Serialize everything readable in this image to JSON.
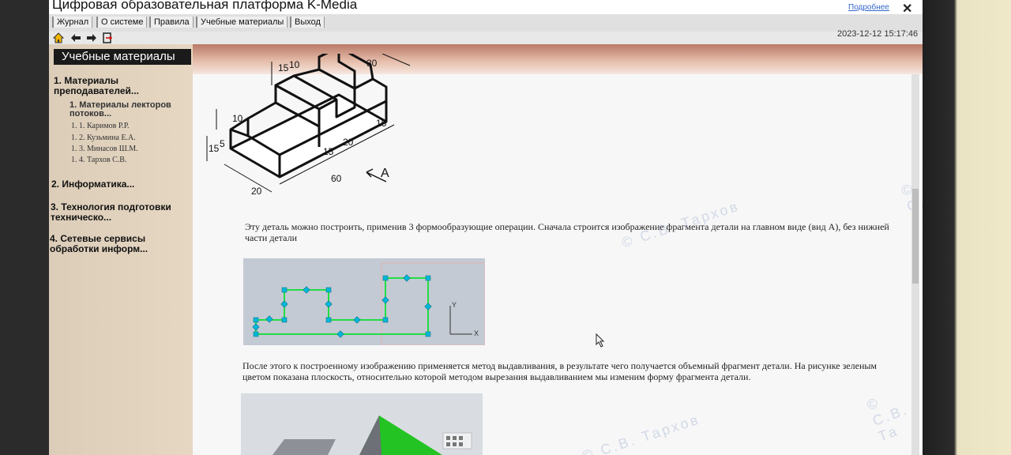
{
  "app": {
    "title": "Цифровая образовательная платформа K-Media",
    "more_link": "Подробнее",
    "close": "✕",
    "datetime": "2023-12-12 15:17:46"
  },
  "menu": [
    "Журнал",
    "О системе",
    "Правила",
    "Учебные материалы",
    "Выход"
  ],
  "toolbar": {
    "icons": [
      "home-icon",
      "back-icon",
      "forward-icon",
      "exit-door-icon"
    ]
  },
  "sidebar": {
    "title": "Учебные материалы",
    "sections": [
      {
        "label": "1. Материалы преподавателей..."
      },
      {
        "label": "1. Материалы лекторов потоков..."
      },
      {
        "label": "2. Информатика..."
      },
      {
        "label": "3. Технология подготовки техническо..."
      },
      {
        "label": "4. Сетевые сервисы обработки информ..."
      }
    ],
    "lecturers": [
      "1. 1. Каримов Р.Р.",
      "1. 2. Кузьмина Е.А.",
      "1. 3. Минасов Ш.М.",
      "1. 4. Тархов С.В."
    ]
  },
  "content": {
    "para1": "Эту деталь можно построить, применив 3 формообразующие операции. Сначала строится изображение фрагмента детали на главном виде (вид А), без нижней части детали",
    "para2": "После этого к построенному изображению применяется метод выдавливания, в результате чего получается объемный фрагмент детали. На рисунке зеленым цветом показана плоскость, относительно которой методом вырезания выдавливанием мы изменим форму фрагмента детали.",
    "dims": [
      "15",
      "10",
      "30",
      "10",
      "15",
      "20",
      "15",
      "5",
      "15",
      "60",
      "20",
      "A"
    ],
    "axis_y": "Y",
    "axis_x": "X",
    "watermarks": [
      "© С.В.",
      "© С.В. Тархов",
      "© С.В. Та",
      "© С.В. Тархов"
    ]
  },
  "colors": {
    "sketch_line": "#22dd44",
    "sketch_point": "#00b7d9",
    "plane_green": "#23c323",
    "header_band": "#b97a66"
  }
}
